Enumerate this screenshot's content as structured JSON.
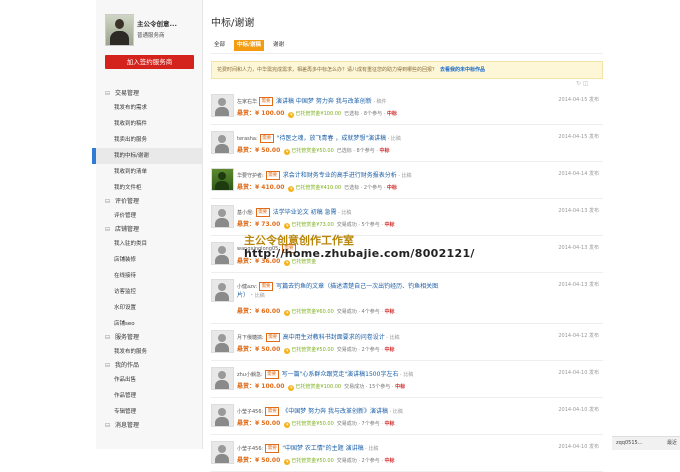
{
  "profile": {
    "name": "主公令创意...",
    "role": "普通服务商"
  },
  "sidebar": {
    "join_label": "加入签约服务商",
    "groups": [
      {
        "title": "交易管理",
        "items": [
          "我发布的需求",
          "我收到的稿件",
          "我卖出的服务",
          "我的中标/谢谢",
          "我收到的清单",
          "我的文件柜"
        ]
      },
      {
        "title": "评价管理",
        "items": [
          "评价管理"
        ]
      },
      {
        "title": "店铺管理",
        "items": [
          "我入驻的类目",
          "店铺装修",
          "在线接待",
          "访客监控",
          "水印设置",
          "店铺seo"
        ]
      },
      {
        "title": "服务管理",
        "items": [
          "我发布的服务"
        ]
      },
      {
        "title": "我的作品",
        "items": [
          "作品出售",
          "作品管理",
          "专辑管理"
        ]
      },
      {
        "title": "消息管理",
        "items": []
      }
    ]
  },
  "main": {
    "title": "中标/谢谢",
    "tabs": [
      "全部",
      "中标/谢稿",
      "谢谢"
    ],
    "notice_text": "花费时间和人力，中华需完成需求，相差再多中标怎么办？请八成有重征您的助力得到哪些的回报？",
    "notice_link": "去看我的未中标作品",
    "tools_text": "↻ ◫"
  },
  "tasks": [
    {
      "user": "左家右华",
      "badge": "需要",
      "title": "演讲稿 中国梦 努力奔 我与改革创新",
      "type": "稿件",
      "price": "悬赏：¥ 100.00",
      "deposit": "已托管赏金¥100.00",
      "status": "已选标",
      "count": "8个参与",
      "result": "中标",
      "date": "2014-04-15 发布"
    },
    {
      "user": "terasha:",
      "badge": "需要",
      "title": "\"待医之魂，放飞青春 ，成就梦想\"演讲稿",
      "type": "比稿",
      "price": "悬赏：¥ 50.00",
      "deposit": "已托管赏金¥50.00",
      "status": "已选标",
      "count": "8个参与",
      "result": "中标",
      "date": "2014-04-15 发布"
    },
    {
      "user": "华要守护者:",
      "badge": "需要",
      "title": "求会计和财务专业的高手进行财务报表分析",
      "type": "比稿",
      "price": "悬赏：¥ 410.00",
      "deposit": "已托管赏金¥410.00",
      "status": "已选标",
      "count": "2个参与",
      "result": "中标",
      "date": "2014-04-14 发布"
    },
    {
      "user": "基小煜:",
      "badge": "需要",
      "title": "法学毕业论文 初稿 急需",
      "type": "比稿",
      "price": "悬赏：¥ 73.00",
      "deposit": "已托管赏金¥73.00",
      "status": "交易成功",
      "count": "5个参与",
      "result": "中标",
      "date": "2014-04-13 发布"
    },
    {
      "user": "wangxinglong05:",
      "badge": "需要",
      "title": "",
      "type": "",
      "price": "悬赏：¥ 36.00",
      "deposit": "已托管赏金",
      "status": "",
      "count": "",
      "result": "",
      "date": "2014-04-13 发布"
    },
    {
      "user": "小健azv:",
      "badge": "需要",
      "title": "写篇去钓鱼的文章（描述清楚自己一次出钓经历、钓鱼相关图",
      "title2": "片）",
      "type": "比稿",
      "price": "悬赏：¥ 60.00",
      "deposit": "已托管赏金¥60.00",
      "status": "交易成功",
      "count": "4个参与",
      "result": "中标",
      "date": "2014-04-13 发布"
    },
    {
      "user": "月下俄糖搞:",
      "badge": "需要",
      "title": "高中用生对教科书封面要求的问卷设计",
      "type": "比稿",
      "price": "悬赏：¥ 50.00",
      "deposit": "已托管赏金¥50.00",
      "status": "交易成功",
      "count": "2个参与",
      "result": "中标",
      "date": "2014-04-12 发布"
    },
    {
      "user": "zhu小躺急:",
      "badge": "需要",
      "title": "写一篇\"心系群众跟党走\"演讲稿1500字左右",
      "type": "比稿",
      "price": "悬赏：¥ 100.00",
      "deposit": "已托管赏金¥100.00",
      "status": "交易成功",
      "count": "15个参与",
      "result": "中标",
      "date": "2014-04-10 发布"
    },
    {
      "user": "小莹子456:",
      "badge": "需要",
      "title": "《中国梦 努力奔 我与改革创新》演讲稿",
      "type": "比稿",
      "price": "悬赏：¥ 50.00",
      "deposit": "已托管赏金¥50.00",
      "status": "交易成功",
      "count": "7个参与",
      "result": "中标",
      "date": "2014-04-10 发布"
    },
    {
      "user": "小莹子456:",
      "badge": "需要",
      "title": "\"中国梦 农工情\"的主题 演讲稿",
      "type": "比稿",
      "price": "悬赏：¥ 50.00",
      "deposit": "已托管赏金¥50.00",
      "status": "交易成功",
      "count": "2个参与",
      "result": "中标",
      "date": "2014-04-10 发布"
    }
  ],
  "watermark": {
    "line1": "主公令创意创作工作室",
    "line2": "http://home.zhubajie.com/8002121/"
  },
  "tray": {
    "left": "zqq0515...",
    "right": "最近"
  },
  "colors": {
    "accent": "#d4231c",
    "link": "#1b5fa8",
    "tab_active": "#f39c12",
    "notice_bg": "#fdf7d7"
  }
}
